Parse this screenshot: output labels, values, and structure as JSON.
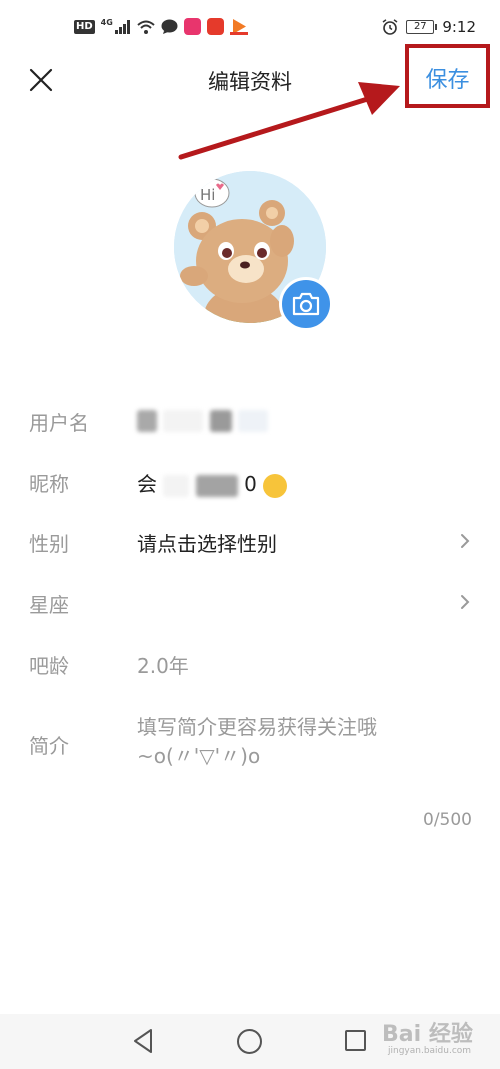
{
  "status_bar": {
    "network": "HD",
    "signal_type": "4G",
    "battery": "27",
    "time": "9:12"
  },
  "header": {
    "title": "编辑资料",
    "save_label": "保存"
  },
  "fields": {
    "username_label": "用户名",
    "nickname_label": "昵称",
    "nickname_prefix": "会",
    "nickname_suffix": "0",
    "gender_label": "性别",
    "gender_value": "请点击选择性别",
    "zodiac_label": "星座",
    "bar_age_label": "吧龄",
    "bar_age_value": "2.0年",
    "intro_label": "简介",
    "intro_placeholder_line1": "填写简介更容易获得关注哦",
    "intro_placeholder_line2": "~o(〃'▽'〃)o",
    "intro_counter": "0/500"
  },
  "watermark": {
    "text": "Bai 经验",
    "sub": "jingyan.baidu.com"
  },
  "colors": {
    "accent": "#3b8fe0",
    "annotation": "#b5191c",
    "label": "#9a9a9a"
  }
}
